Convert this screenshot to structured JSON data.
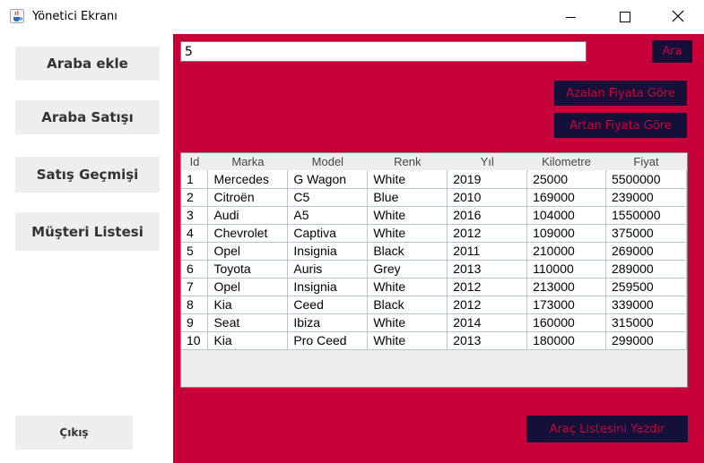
{
  "window": {
    "title": "Yönetici Ekranı",
    "accent_color": "#c8003a",
    "dark_button_color": "#14103a",
    "icons": {
      "app": "java-coffee-icon",
      "minimize": "minimize-icon",
      "maximize": "maximize-icon",
      "close": "close-icon"
    }
  },
  "sidebar": {
    "items": [
      {
        "label": "Araba ekle"
      },
      {
        "label": "Araba Satışı"
      },
      {
        "label": "Satış Geçmişi"
      },
      {
        "label": "Müşteri Listesi"
      }
    ],
    "exit_label": "Çıkış"
  },
  "main": {
    "search": {
      "value": "5"
    },
    "search_button": "Ara",
    "sort_desc_button": "Azalan Fiyata Göre",
    "sort_asc_button": "Artan Fiyata Göre",
    "print_button": "Araç Listesini Yazdır",
    "table": {
      "columns": [
        "Id",
        "Marka",
        "Model",
        "Renk",
        "Yıl",
        "Kilometre",
        "Fiyat"
      ],
      "rows": [
        [
          "1",
          "Mercedes",
          "G Wagon",
          "White",
          "2019",
          "25000",
          "5500000"
        ],
        [
          "2",
          "Citroën",
          "C5",
          "Blue",
          "2010",
          "169000",
          "239000"
        ],
        [
          "3",
          "Audi",
          "A5",
          "White",
          "2016",
          "104000",
          "1550000"
        ],
        [
          "4",
          "Chevrolet",
          "Captiva",
          "White",
          "2012",
          "109000",
          "375000"
        ],
        [
          "5",
          "Opel",
          "Insignia",
          "Black",
          "2011",
          "210000",
          "269000"
        ],
        [
          "6",
          "Toyota",
          "Auris",
          "Grey",
          "2013",
          "110000",
          "289000"
        ],
        [
          "7",
          "Opel",
          "Insignia",
          "White",
          "2012",
          "213000",
          "259500"
        ],
        [
          "8",
          "Kia",
          "Ceed",
          "Black",
          "2012",
          "173000",
          "339000"
        ],
        [
          "9",
          "Seat",
          "Ibiza",
          "White",
          "2014",
          "160000",
          "315000"
        ],
        [
          "10",
          "Kia",
          "Pro Ceed",
          "White",
          "2013",
          "180000",
          "299000"
        ]
      ]
    }
  }
}
